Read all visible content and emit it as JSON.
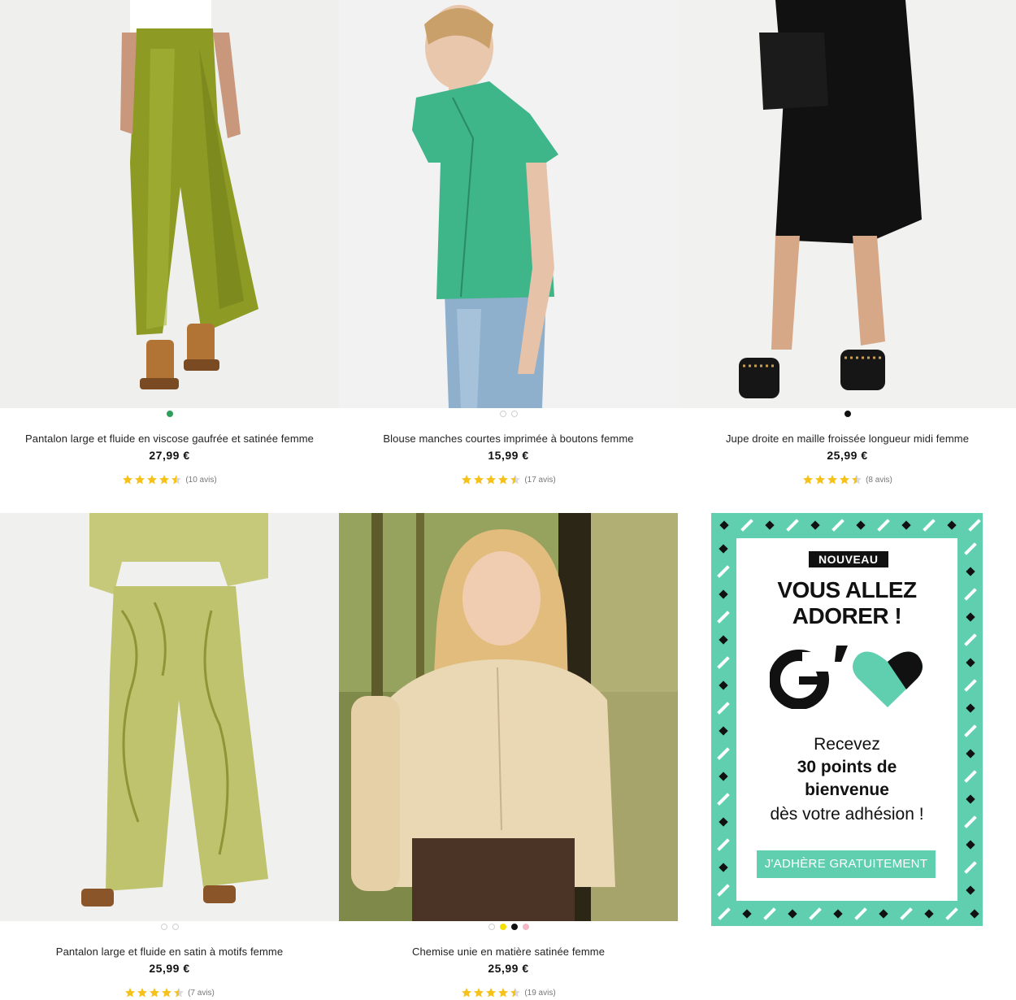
{
  "products": [
    {
      "title": "Pantalon large et fluide en viscose gaufrée et satinée femme",
      "price": "27,99 €",
      "reviews": "(10 avis)",
      "rating": 4.5,
      "swatches": [
        "#2e9e5b"
      ],
      "image": "olive satin wide-leg trousers with sandals"
    },
    {
      "title": "Blouse manches courtes imprimée à boutons femme",
      "price": "15,99 €",
      "reviews": "(17 avis)",
      "rating": 4.5,
      "swatches": [
        "#ffffff",
        "#ffffff"
      ],
      "image": "green printed short-sleeve blouse with jeans"
    },
    {
      "title": "Jupe droite en maille froissée longueur midi femme",
      "price": "25,99 €",
      "reviews": "(8 avis)",
      "rating": 4.5,
      "swatches": [
        "#111111"
      ],
      "image": "black midi skirt with studded sandals and bag"
    },
    {
      "title": "Pantalon large et fluide en satin à motifs femme",
      "price": "25,99 €",
      "reviews": "(7 avis)",
      "rating": 4.5,
      "swatches": [
        "#ffffff",
        "#ffffff"
      ],
      "image": "patterned lime satin wide trousers"
    },
    {
      "title": "Chemise unie en matière satinée femme",
      "price": "25,99 €",
      "reviews": "(19 avis)",
      "rating": 4.5,
      "swatches": [
        "#ffffff",
        "#f2e000",
        "#111111",
        "#f4b9c4"
      ],
      "image": "cream satin shirt, woman in forest"
    }
  ],
  "promo": {
    "badge": "NOUVEAU",
    "headline_1": "VOUS ALLEZ",
    "headline_2": "ADORER !",
    "line_1": "Recevez",
    "line_2": "30 points de",
    "line_3": "bienvenue",
    "line_4": "dès votre adhésion !",
    "cta": "J'ADHÈRE GRATUITEMENT",
    "accent": "#5fcfb0"
  },
  "colors": {
    "star": "#f6c21a",
    "star_empty": "#d9d9d9"
  }
}
